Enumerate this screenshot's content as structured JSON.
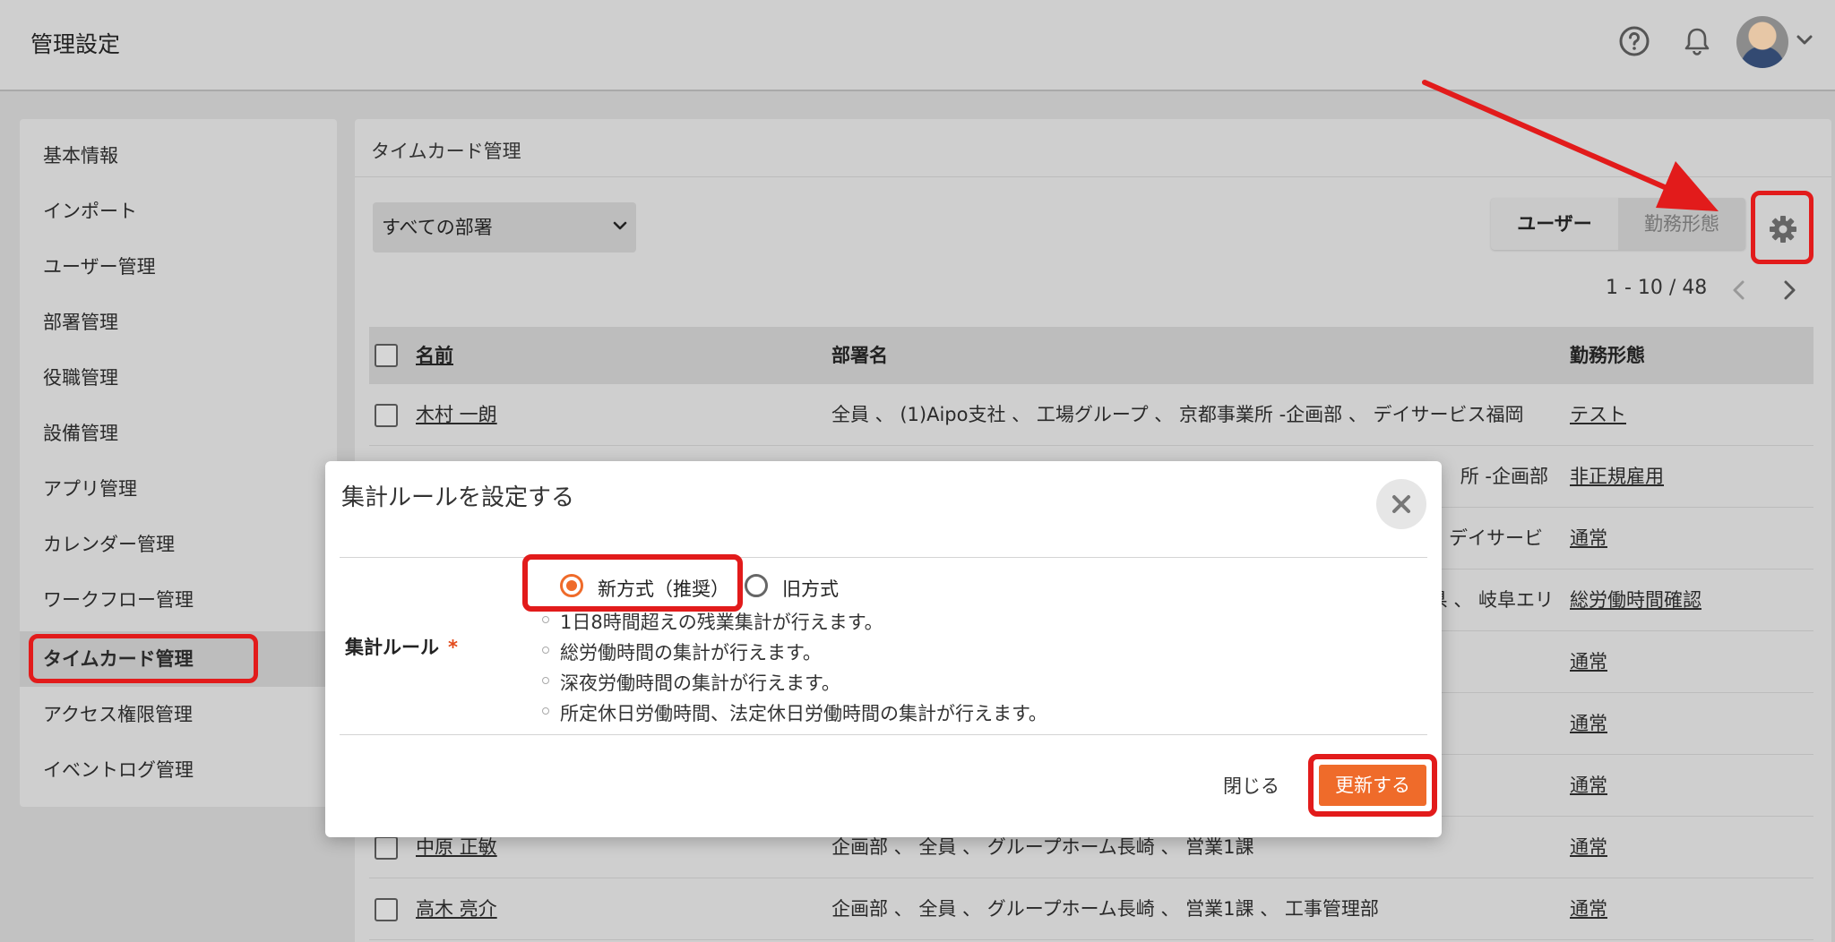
{
  "header": {
    "title": "管理設定",
    "icons": [
      "help-icon",
      "bell-icon",
      "avatar",
      "chevron-down-icon"
    ]
  },
  "sidebar": {
    "items": [
      {
        "label": "基本情報"
      },
      {
        "label": "インポート"
      },
      {
        "label": "ユーザー管理"
      },
      {
        "label": "部署管理"
      },
      {
        "label": "役職管理"
      },
      {
        "label": "設備管理"
      },
      {
        "label": "アプリ管理"
      },
      {
        "label": "カレンダー管理"
      },
      {
        "label": "ワークフロー管理"
      },
      {
        "label": "タイムカード管理",
        "active": true
      },
      {
        "label": "アクセス権限管理"
      },
      {
        "label": "イベントログ管理"
      }
    ]
  },
  "main": {
    "title": "タイムカード管理",
    "department_select": "すべての部署",
    "tabs": [
      {
        "label": "ユーザー",
        "active": true
      },
      {
        "label": "勤務形態",
        "active": false
      }
    ],
    "settings_icon": "gear-icon",
    "pager": {
      "range": "1 - 10 / 48"
    },
    "table": {
      "headers": [
        "名前",
        "部署名",
        "勤務形態"
      ],
      "rows": [
        {
          "name": "木村 一朗",
          "dept": "全員 、 (1)Aipo支社 、 工場グループ 、 京都事業所 -企画部 、 デイサービス福岡",
          "work": "テスト"
        },
        {
          "name": "",
          "dept": "所 -企画部",
          "work": "非正規雇用"
        },
        {
          "name": "",
          "dept": "デイサービ",
          "work": "通常"
        },
        {
          "name": "",
          "dept": "県 、 岐阜エリ",
          "work": "総労働時間確認"
        },
        {
          "name": "",
          "dept": "",
          "work": "通常"
        },
        {
          "name": "",
          "dept": "",
          "work": "通常"
        },
        {
          "name": "",
          "dept": "",
          "work": "通常"
        },
        {
          "name": "中原 正敏",
          "dept": "企画部 、 全員 、 グループホーム長崎 、 営業1課",
          "work": "通常"
        },
        {
          "name": "高木 亮介",
          "dept": "企画部 、 全員 、 グループホーム長崎 、 営業1課 、 工事管理部",
          "work": "通常"
        }
      ]
    }
  },
  "modal": {
    "title": "集計ルールを設定する",
    "field_label": "集計ルール",
    "required_mark": "*",
    "options": [
      {
        "label": "新方式（推奨）",
        "selected": true
      },
      {
        "label": "旧方式",
        "selected": false
      }
    ],
    "notes": [
      "1日8時間超えの残業集計が行えます。",
      "総労働時間の集計が行えます。",
      "深夜労働時間の集計が行えます。",
      "所定休日労働時間、法定休日労働時間の集計が行えます。"
    ],
    "close_label": "閉じる",
    "update_label": "更新する"
  },
  "colors": {
    "accent": "#ef6b2a",
    "annotation_red": "#e21b1b",
    "overlay_bg": "#c2c2c2"
  }
}
